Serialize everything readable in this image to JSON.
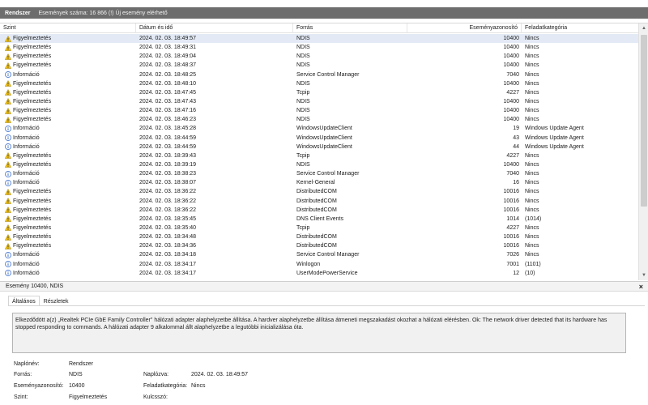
{
  "titlebar": {
    "title": "Rendszer",
    "info": "Események száma: 16 866 (!) Új esemény elérhető"
  },
  "columns": {
    "level": "Szint",
    "date": "Dátum és idő",
    "source": "Forrás",
    "event_id": "Eseményazonosító",
    "category": "Feladatkategória"
  },
  "rows": [
    {
      "level": "Figyelmeztetés",
      "type": "warning",
      "date": "2024. 02. 03. 18:49:57",
      "source": "NDIS",
      "id": "10400",
      "category": "Nincs",
      "selected": true
    },
    {
      "level": "Figyelmeztetés",
      "type": "warning",
      "date": "2024. 02. 03. 18:49:31",
      "source": "NDIS",
      "id": "10400",
      "category": "Nincs"
    },
    {
      "level": "Figyelmeztetés",
      "type": "warning",
      "date": "2024. 02. 03. 18:49:04",
      "source": "NDIS",
      "id": "10400",
      "category": "Nincs"
    },
    {
      "level": "Figyelmeztetés",
      "type": "warning",
      "date": "2024. 02. 03. 18:48:37",
      "source": "NDIS",
      "id": "10400",
      "category": "Nincs"
    },
    {
      "level": "Információ",
      "type": "info",
      "date": "2024. 02. 03. 18:48:25",
      "source": "Service Control Manager",
      "id": "7040",
      "category": "Nincs"
    },
    {
      "level": "Figyelmeztetés",
      "type": "warning",
      "date": "2024. 02. 03. 18:48:10",
      "source": "NDIS",
      "id": "10400",
      "category": "Nincs"
    },
    {
      "level": "Figyelmeztetés",
      "type": "warning",
      "date": "2024. 02. 03. 18:47:45",
      "source": "Tcpip",
      "id": "4227",
      "category": "Nincs"
    },
    {
      "level": "Figyelmeztetés",
      "type": "warning",
      "date": "2024. 02. 03. 18:47:43",
      "source": "NDIS",
      "id": "10400",
      "category": "Nincs"
    },
    {
      "level": "Figyelmeztetés",
      "type": "warning",
      "date": "2024. 02. 03. 18:47:16",
      "source": "NDIS",
      "id": "10400",
      "category": "Nincs"
    },
    {
      "level": "Figyelmeztetés",
      "type": "warning",
      "date": "2024. 02. 03. 18:46:23",
      "source": "NDIS",
      "id": "10400",
      "category": "Nincs"
    },
    {
      "level": "Információ",
      "type": "info",
      "date": "2024. 02. 03. 18:45:28",
      "source": "WindowsUpdateClient",
      "id": "19",
      "category": "Windows Update Agent"
    },
    {
      "level": "Információ",
      "type": "info",
      "date": "2024. 02. 03. 18:44:59",
      "source": "WindowsUpdateClient",
      "id": "43",
      "category": "Windows Update Agent"
    },
    {
      "level": "Információ",
      "type": "info",
      "date": "2024. 02. 03. 18:44:59",
      "source": "WindowsUpdateClient",
      "id": "44",
      "category": "Windows Update Agent"
    },
    {
      "level": "Figyelmeztetés",
      "type": "warning",
      "date": "2024. 02. 03. 18:39:43",
      "source": "Tcpip",
      "id": "4227",
      "category": "Nincs"
    },
    {
      "level": "Figyelmeztetés",
      "type": "warning",
      "date": "2024. 02. 03. 18:39:19",
      "source": "NDIS",
      "id": "10400",
      "category": "Nincs"
    },
    {
      "level": "Információ",
      "type": "info",
      "date": "2024. 02. 03. 18:38:23",
      "source": "Service Control Manager",
      "id": "7040",
      "category": "Nincs"
    },
    {
      "level": "Információ",
      "type": "info",
      "date": "2024. 02. 03. 18:38:07",
      "source": "Kernel-General",
      "id": "16",
      "category": "Nincs"
    },
    {
      "level": "Figyelmeztetés",
      "type": "warning",
      "date": "2024. 02. 03. 18:36:22",
      "source": "DistributedCOM",
      "id": "10016",
      "category": "Nincs"
    },
    {
      "level": "Figyelmeztetés",
      "type": "warning",
      "date": "2024. 02. 03. 18:36:22",
      "source": "DistributedCOM",
      "id": "10016",
      "category": "Nincs"
    },
    {
      "level": "Figyelmeztetés",
      "type": "warning",
      "date": "2024. 02. 03. 18:36:22",
      "source": "DistributedCOM",
      "id": "10016",
      "category": "Nincs"
    },
    {
      "level": "Figyelmeztetés",
      "type": "warning",
      "date": "2024. 02. 03. 18:35:45",
      "source": "DNS Client Events",
      "id": "1014",
      "category": "(1014)"
    },
    {
      "level": "Figyelmeztetés",
      "type": "warning",
      "date": "2024. 02. 03. 18:35:40",
      "source": "Tcpip",
      "id": "4227",
      "category": "Nincs"
    },
    {
      "level": "Figyelmeztetés",
      "type": "warning",
      "date": "2024. 02. 03. 18:34:48",
      "source": "DistributedCOM",
      "id": "10016",
      "category": "Nincs"
    },
    {
      "level": "Figyelmeztetés",
      "type": "warning",
      "date": "2024. 02. 03. 18:34:36",
      "source": "DistributedCOM",
      "id": "10016",
      "category": "Nincs"
    },
    {
      "level": "Információ",
      "type": "info",
      "date": "2024. 02. 03. 18:34:18",
      "source": "Service Control Manager",
      "id": "7026",
      "category": "Nincs"
    },
    {
      "level": "Információ",
      "type": "info",
      "date": "2024. 02. 03. 18:34:17",
      "source": "Winlogon",
      "id": "7001",
      "category": "(1101)"
    },
    {
      "level": "Információ",
      "type": "info",
      "date": "2024. 02. 03. 18:34:17",
      "source": "UserModePowerService",
      "id": "12",
      "category": "(10)"
    }
  ],
  "detail": {
    "title": "Esemény 10400, NDIS",
    "close_label": "×",
    "tabs": [
      "Általános",
      "Részletek"
    ],
    "message": "Elkezdődött a(z) „Realtek PCIe GbE Family Controller\" hálózati adapter alaphelyzetbe állítása. A hardver alaphelyzetbe állítása átmeneti megszakadást okozhat a hálózati elérésben. Ok: The network driver detected that its hardware has stopped responding to commands. A hálózati adapter 9 alkalommal állt alaphelyzetbe a legutóbbi inicializálása óta.",
    "props": {
      "log_name_label": "Naplónév:",
      "log_name_value": "Rendszer",
      "source_label": "Forrás:",
      "source_value": "NDIS",
      "logged_label": "Naplózva:",
      "logged_value": "2024. 02. 03. 18:49:57",
      "event_id_label": "Eseményazonosító:",
      "event_id_value": "10400",
      "task_label": "Feladatkategória:",
      "task_value": "Nincs",
      "level_label": "Szint:",
      "level_value": "Figyelmeztetés",
      "keywords_label": "Kulcsszó:"
    }
  },
  "icons": {
    "warning": "warning-icon",
    "info": "info-icon"
  },
  "colors": {
    "titlebar_bg": "#6d6d6d",
    "selected_row": "#e3eaf5",
    "warning_yellow": "#f5c518",
    "info_blue": "#2b63c6"
  }
}
